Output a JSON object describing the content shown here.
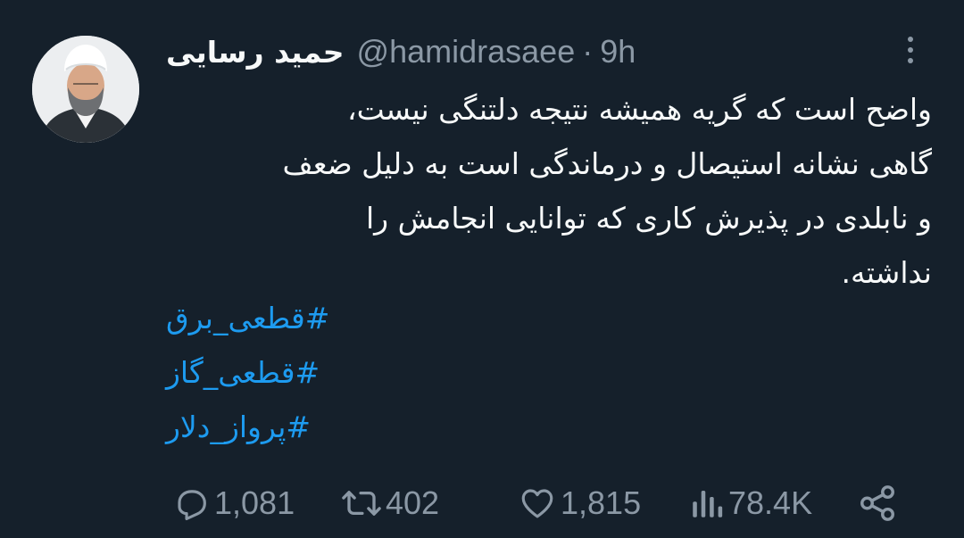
{
  "tweet": {
    "display_name": "حمید رسایی",
    "handle": "@hamidrasaee",
    "separator": "·",
    "time": "9h",
    "text": "واضح است که گریه همیشه نتیجه دلتنگی نیست،\nگاهی نشانه استیصال و درماندگی است به دلیل ضعف\nو نابلدی در پذیرش کاری که توانایی انجامش را\nنداشته.",
    "hashtags": [
      "#قطعی_برق",
      "#قطعی_گاز",
      "#پرواز_دلار"
    ]
  },
  "actions": {
    "replies": "1,081",
    "retweets": "402",
    "likes": "1,815",
    "views": "78.4K"
  },
  "icons": {
    "more": "more-vertical-icon",
    "reply": "reply-icon",
    "retweet": "retweet-icon",
    "like": "heart-icon",
    "views": "analytics-icon",
    "share": "share-icon"
  },
  "colors": {
    "background": "#15202b",
    "text": "#f7f9f9",
    "secondary": "#8b98a5",
    "link": "#1d9bf0"
  }
}
